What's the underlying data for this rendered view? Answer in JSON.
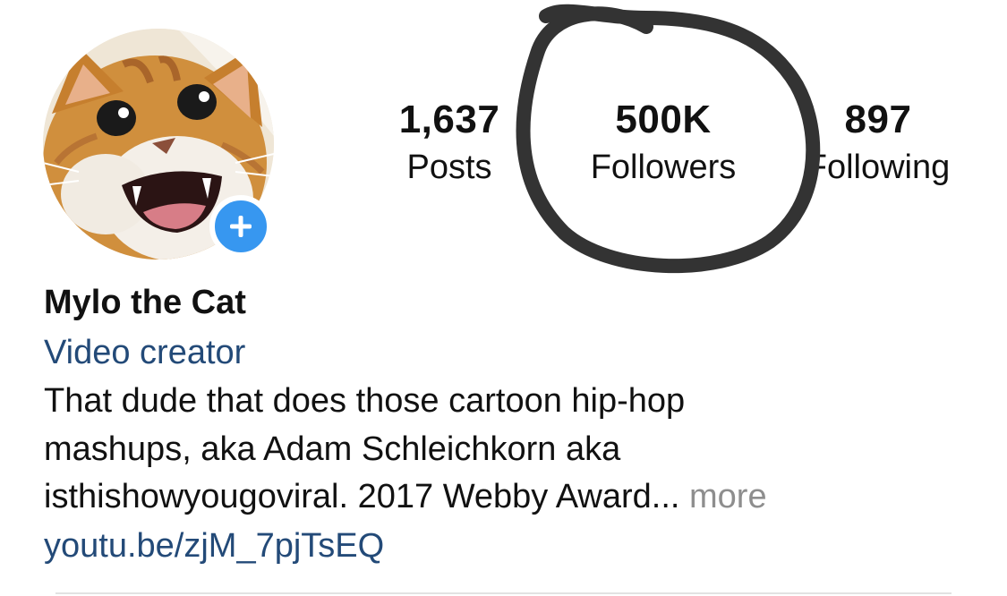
{
  "profile": {
    "avatar_alt": "Mylo the Cat",
    "add_icon": "plus-icon",
    "accent_color": "#3797f0"
  },
  "stats": {
    "posts": {
      "value": "1,637",
      "label": "Posts"
    },
    "followers": {
      "value": "500K",
      "label": "Followers"
    },
    "following": {
      "value": "897",
      "label": "Following"
    }
  },
  "bio": {
    "name": "Mylo the Cat",
    "category": "Video creator",
    "lines": [
      "That dude that does those cartoon hip-hop",
      "mashups, aka Adam Schleichkorn aka",
      "isthishowyougoviral. 2017 Webby Award..."
    ],
    "more": "more",
    "link": "youtu.be/zjM_7pjTsEQ",
    "link_color": "#234a78"
  }
}
